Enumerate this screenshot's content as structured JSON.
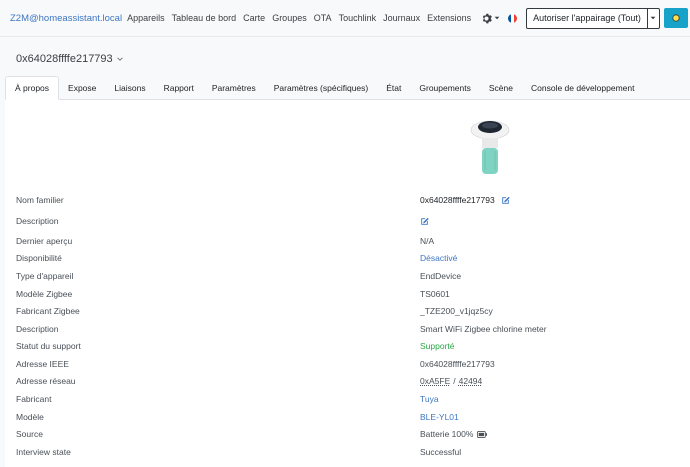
{
  "navbar": {
    "brand": "Z2M@homeassistant.local",
    "items": [
      "Appareils",
      "Tableau de bord",
      "Carte",
      "Groupes",
      "OTA",
      "Touchlink",
      "Journaux",
      "Extensions"
    ],
    "permit_label": "Autoriser l'appairage (Tout)"
  },
  "device": {
    "selected": "0x64028ffffe217793",
    "image_alt": ""
  },
  "tabs": [
    "À propos",
    "Expose",
    "Liaisons",
    "Rapport",
    "Paramètres",
    "Paramètres (spécifiques)",
    "État",
    "Groupements",
    "Scène",
    "Console de développement"
  ],
  "info": {
    "friendly_name_label": "Nom familier",
    "friendly_name": "0x64028ffffe217793",
    "description_label": "Description",
    "last_seen_label": "Dernier aperçu",
    "last_seen": "N/A",
    "availability_label": "Disponibilité",
    "availability": "Désactivé",
    "type_label": "Type d'appareil",
    "type": "EndDevice",
    "model_zigbee_label": "Modèle Zigbee",
    "model_zigbee": "TS0601",
    "manufacturer_zigbee_label": "Fabricant Zigbee",
    "manufacturer_zigbee": "_TZE200_v1jqz5cy",
    "description2_label": "Description",
    "description2": "Smart WiFi Zigbee chlorine meter",
    "support_label": "Statut du support",
    "support": "Supporté",
    "ieee_label": "Adresse IEEE",
    "ieee": "0x64028ffffe217793",
    "network_label": "Adresse réseau",
    "network_hex": "0xA5FE",
    "network_sep": "/",
    "network_dec": "42494",
    "vendor_label": "Fabricant",
    "vendor": "Tuya",
    "model_label": "Modèle",
    "model": "BLE-YL01",
    "source_label": "Source",
    "source": "Batterie 100%",
    "interview_label": "Interview state",
    "interview": "Successful"
  },
  "colors": {
    "link": "#3d77c2",
    "green": "#28a745",
    "cyan": "#17a2c9"
  }
}
